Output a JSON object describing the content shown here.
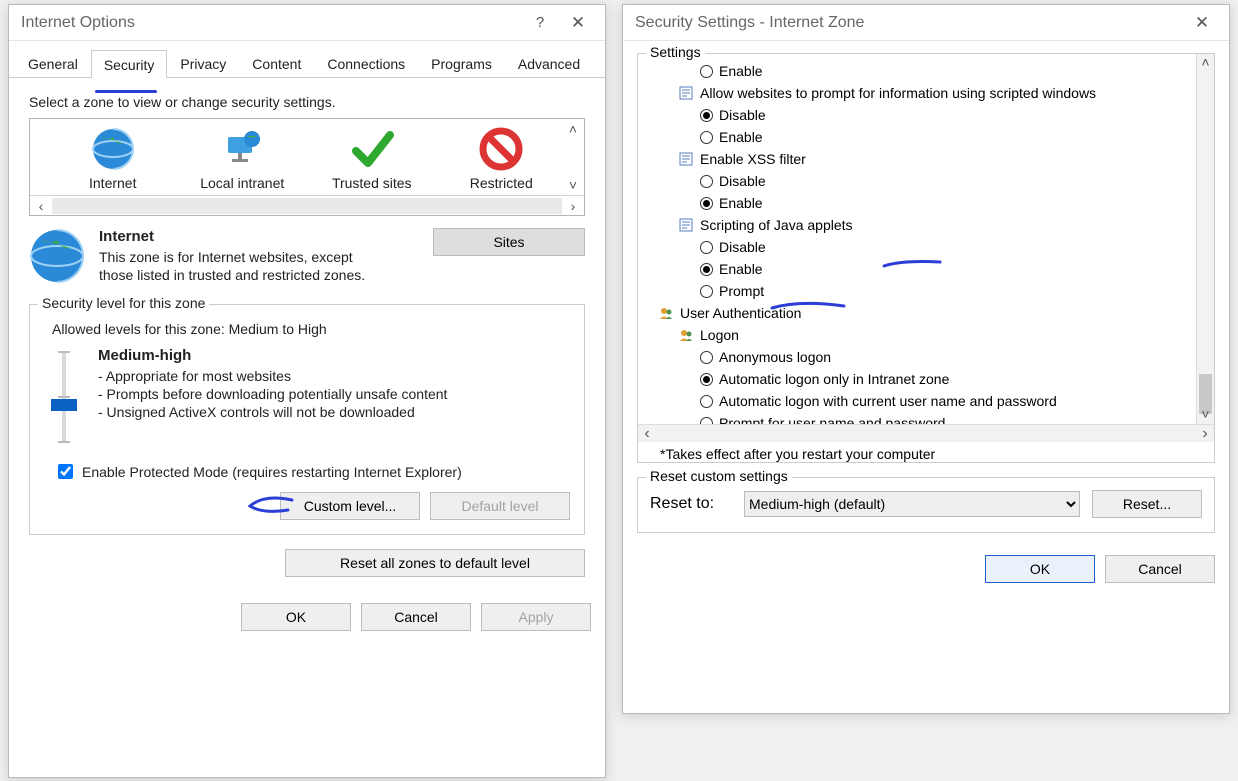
{
  "left": {
    "title": "Internet Options",
    "tabs": [
      "General",
      "Security",
      "Privacy",
      "Content",
      "Connections",
      "Programs",
      "Advanced"
    ],
    "active_tab": 1,
    "zone_instruction": "Select a zone to view or change security settings.",
    "zones": [
      "Internet",
      "Local intranet",
      "Trusted sites",
      "Restricted"
    ],
    "zone_name": "Internet",
    "zone_desc": "This zone is for Internet websites, except those listed in trusted and restricted zones.",
    "sites_btn": "Sites",
    "sec_legend": "Security level for this zone",
    "allowed": "Allowed levels for this zone: Medium to High",
    "level_name": "Medium-high",
    "bullets": [
      "- Appropriate for most websites",
      "- Prompts before downloading potentially unsafe content",
      "- Unsigned ActiveX controls will not be downloaded"
    ],
    "protected": "Enable Protected Mode (requires restarting Internet Explorer)",
    "custom_btn": "Custom level...",
    "default_btn": "Default level",
    "reset_btn": "Reset all zones to default level",
    "ok": "OK",
    "cancel": "Cancel",
    "apply": "Apply"
  },
  "right": {
    "title": "Security Settings - Internet Zone",
    "legend": "Settings",
    "tree": [
      {
        "opt": "Enable",
        "sel": false
      },
      {
        "cat": "Allow websites to prompt for information using scripted windows",
        "ico": "script"
      },
      {
        "opt": "Disable",
        "sel": true
      },
      {
        "opt": "Enable",
        "sel": false
      },
      {
        "cat": "Enable XSS filter",
        "ico": "script"
      },
      {
        "opt": "Disable",
        "sel": false
      },
      {
        "opt": "Enable",
        "sel": true
      },
      {
        "cat": "Scripting of Java applets",
        "ico": "script"
      },
      {
        "opt": "Disable",
        "sel": false
      },
      {
        "opt": "Enable",
        "sel": true
      },
      {
        "opt": "Prompt",
        "sel": false
      },
      {
        "cat": "User Authentication",
        "ico": "users",
        "top": true
      },
      {
        "cat": "Logon",
        "ico": "users"
      },
      {
        "opt": "Anonymous logon",
        "sel": false
      },
      {
        "opt": "Automatic logon only in Intranet zone",
        "sel": true
      },
      {
        "opt": "Automatic logon with current user name and password",
        "sel": false
      },
      {
        "opt": "Prompt for user name and password",
        "sel": false
      }
    ],
    "note": "*Takes effect after you restart your computer",
    "reset_legend": "Reset custom settings",
    "reset_label": "Reset to:",
    "reset_value": "Medium-high (default)",
    "reset_btn": "Reset...",
    "ok": "OK",
    "cancel": "Cancel"
  }
}
